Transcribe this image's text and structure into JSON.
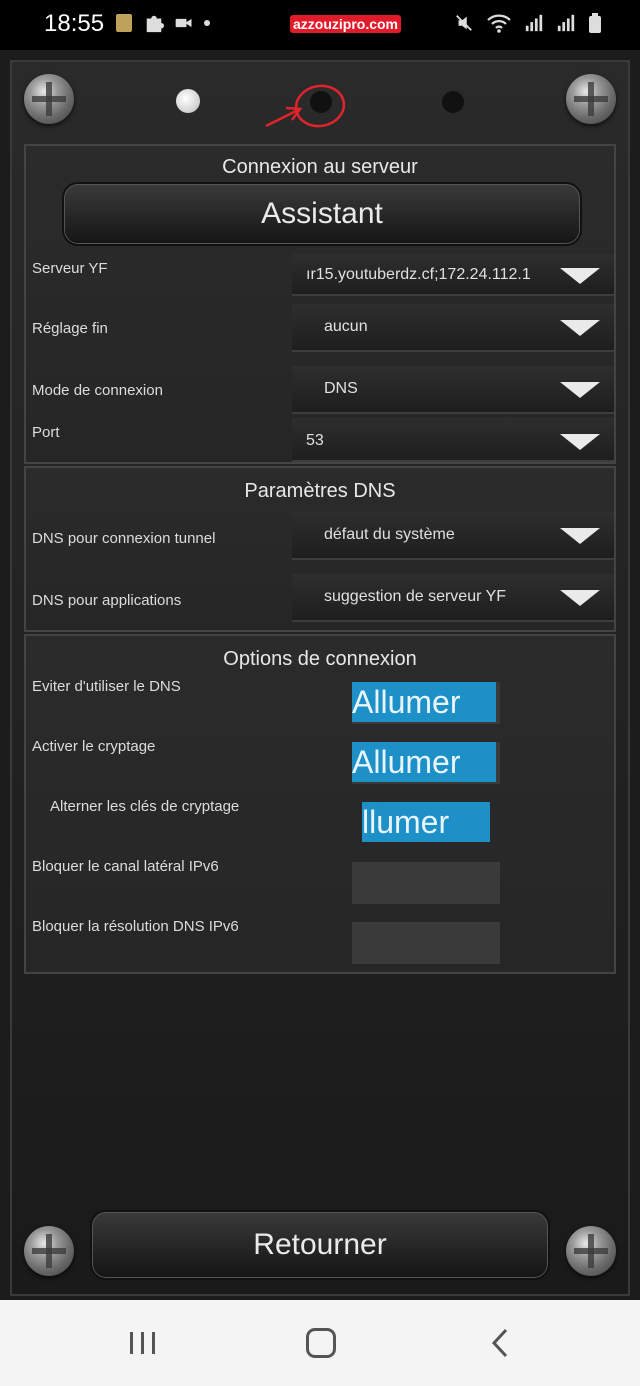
{
  "status": {
    "time": "18:55",
    "watermark": "azzouzipro.com"
  },
  "connexion": {
    "title": "Connexion au serveur",
    "assistant_label": "Assistant",
    "rows": [
      {
        "label": "Serveur YF",
        "value": "ır15.youtuberdz.cf;172.24.112.1"
      },
      {
        "label": "Réglage fin",
        "value": "aucun"
      },
      {
        "label": "Mode de connexion",
        "value": "DNS"
      },
      {
        "label": "Port",
        "value": "53"
      }
    ]
  },
  "dns": {
    "title": "Paramètres DNS",
    "rows": [
      {
        "label": "DNS pour connexion tunnel",
        "value": "défaut du système"
      },
      {
        "label": "DNS pour applications",
        "value": "suggestion de serveur YF"
      }
    ]
  },
  "options": {
    "title": "Options de connexion",
    "rows": [
      {
        "label": "Eviter d'utiliser le DNS",
        "toggle_label": "Allumer",
        "on": true
      },
      {
        "label": "Activer le cryptage",
        "toggle_label": "Allumer",
        "on": true
      },
      {
        "label": "Alterner les clés de cryptage",
        "toggle_label": "llumer",
        "on": true
      },
      {
        "label": "Bloquer le canal latéral IPv6",
        "toggle_label": "",
        "on": false
      },
      {
        "label": "Bloquer la résolution DNS IPv6",
        "toggle_label": "",
        "on": false
      }
    ]
  },
  "footer": {
    "return_label": "Retourner"
  },
  "icons": {
    "screw": "screw-icon",
    "dropdown": "triangle-down-icon",
    "nav_recent": "recent-apps-icon",
    "nav_home": "home-icon",
    "nav_back": "back-icon"
  },
  "colors": {
    "toggle_on": "#1e90c8",
    "annotation": "#e0242c"
  }
}
